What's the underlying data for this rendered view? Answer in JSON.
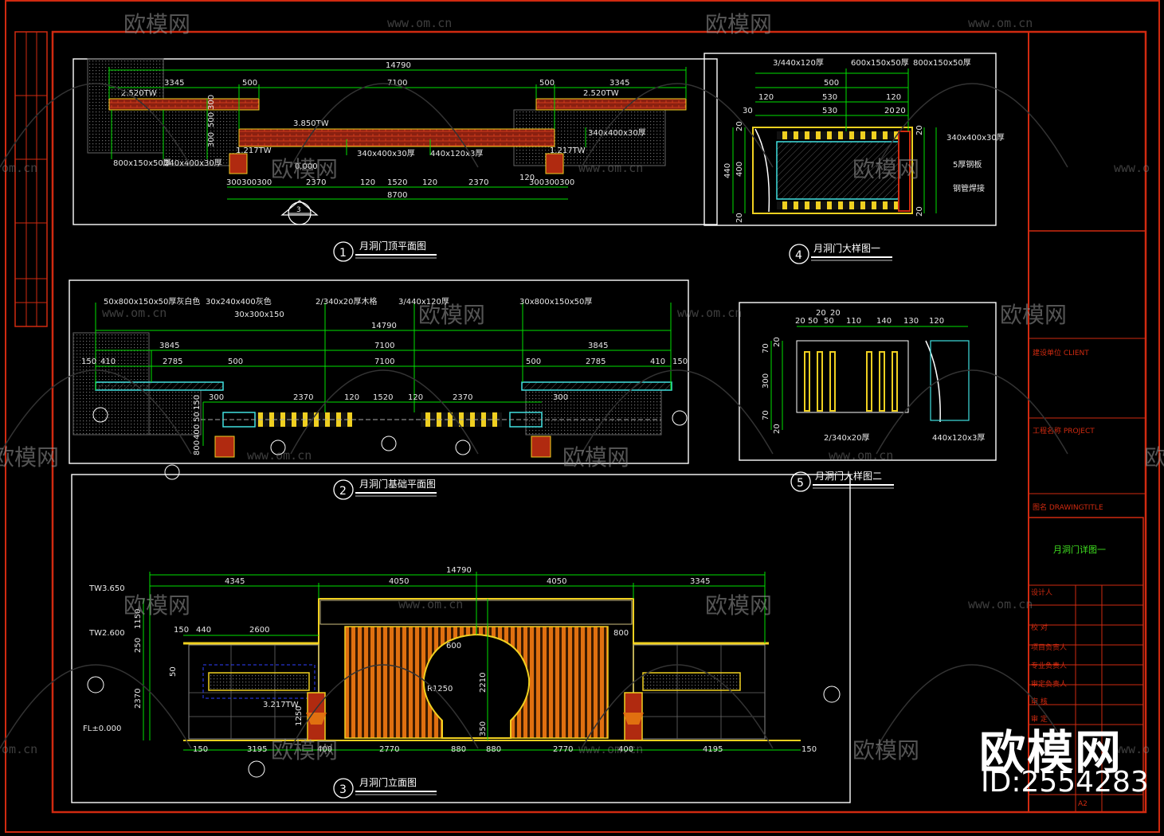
{
  "watermark": {
    "brand": "欧模网",
    "url": "www.om.cn",
    "url_partial": "om.cn",
    "url_partial_2": "www.o"
  },
  "brand": {
    "name": "欧模网",
    "id_text": "ID:2554283"
  },
  "drawings": {
    "d1": {
      "num": "1",
      "title": "月洞门顶平面图"
    },
    "d2": {
      "num": "2",
      "title": "月洞门基础平面图"
    },
    "d3": {
      "num": "3",
      "title": "月洞门立面图"
    },
    "d4": {
      "num": "4",
      "title": "月洞门大样图一"
    },
    "d5": {
      "num": "5",
      "title": "月洞门大样图二"
    }
  },
  "plan1": {
    "dims_top": [
      "14790",
      "3345",
      "500",
      "7100",
      "500",
      "3345"
    ],
    "elev_left": "2.520TW",
    "elev_right": "2.520TW",
    "elev_center": "3.850TW",
    "elev_post_l": "1.217TW",
    "elev_post_r": "1.217TW",
    "elev_zero": "0.000",
    "vdims": [
      "300",
      "500",
      "300"
    ],
    "notes": [
      "800x150x50厚",
      "240x400x30厚",
      "340x400x30厚",
      "440x120x3厚",
      "340x400x30厚"
    ],
    "dims_bottom": [
      "300300300",
      "2370",
      "120",
      "1520",
      "120",
      "2370",
      "120",
      "300300300",
      "8700"
    ],
    "section_mark": "3"
  },
  "plan2": {
    "notes_top": [
      "50x800x150x50厚灰白色",
      "30x240x400灰色",
      "2/340x20厚木格",
      "3/440x120厚",
      "30x800x150x50厚",
      "30x300x150"
    ],
    "dims": [
      "14790",
      "3845",
      "7100",
      "3845",
      "2785",
      "500",
      "7100",
      "500",
      "2785",
      "410",
      "150",
      "150",
      "410"
    ],
    "dims_bottom": [
      "300",
      "2370",
      "120",
      "1520",
      "120",
      "2370",
      "300"
    ],
    "vdims": [
      "150",
      "50",
      "400",
      "800"
    ]
  },
  "elev3": {
    "dims_top": [
      "14790",
      "4345",
      "4050",
      "4050",
      "3345"
    ],
    "dims_mid": [
      "150",
      "440",
      "2600",
      "600",
      "800"
    ],
    "levels": [
      "TW3.650",
      "TW2.600",
      "FL±0.000"
    ],
    "vdims": [
      "1150",
      "250",
      "50",
      "2370",
      "2210",
      "350",
      "1250"
    ],
    "dims_bottom": [
      "150",
      "3195",
      "400",
      "2770",
      "880",
      "880",
      "2770",
      "400",
      "4195",
      "150"
    ],
    "elev_post": "3.217TW",
    "arch_label": "R1250"
  },
  "detail4": {
    "notes": [
      "3/440x120厚",
      "600x150x50厚",
      "800x150x50厚",
      "340x400x30厚",
      "5厚钢板",
      "钢管焊接"
    ],
    "dims_top": [
      "500",
      "120",
      "530",
      "530",
      "120",
      "20",
      "20",
      "30"
    ],
    "vdims": [
      "440",
      "400",
      "20",
      "20",
      "20",
      "20"
    ]
  },
  "detail5": {
    "dims_top": [
      "20",
      "50",
      "20",
      "50",
      "20",
      "110",
      "140",
      "130",
      "120"
    ],
    "vdims": [
      "70",
      "300",
      "70",
      "20",
      "20"
    ],
    "notes": [
      "2/340x20厚",
      "440x120x3厚"
    ]
  },
  "titleblock": {
    "client": "建设单位 CLIENT",
    "project": "工程名称 PROJECT",
    "drawing": "图名 DRAWINGTITLE",
    "drawing_name": "月洞门详图一",
    "roles": [
      "设计人",
      "校 对",
      "项目负责人",
      "专业负责人",
      "审定负责人",
      "审 核",
      "审 定"
    ],
    "sheet": "A2"
  },
  "colors": {
    "background": "#000000",
    "frame": "#d02a10",
    "dimension": "#00e000",
    "wood": "#e07010",
    "brick": "#b02a10",
    "yellow": "#f0d020",
    "white": "#ffffff",
    "cyan": "#40e0e0",
    "blue": "#3040ff"
  }
}
